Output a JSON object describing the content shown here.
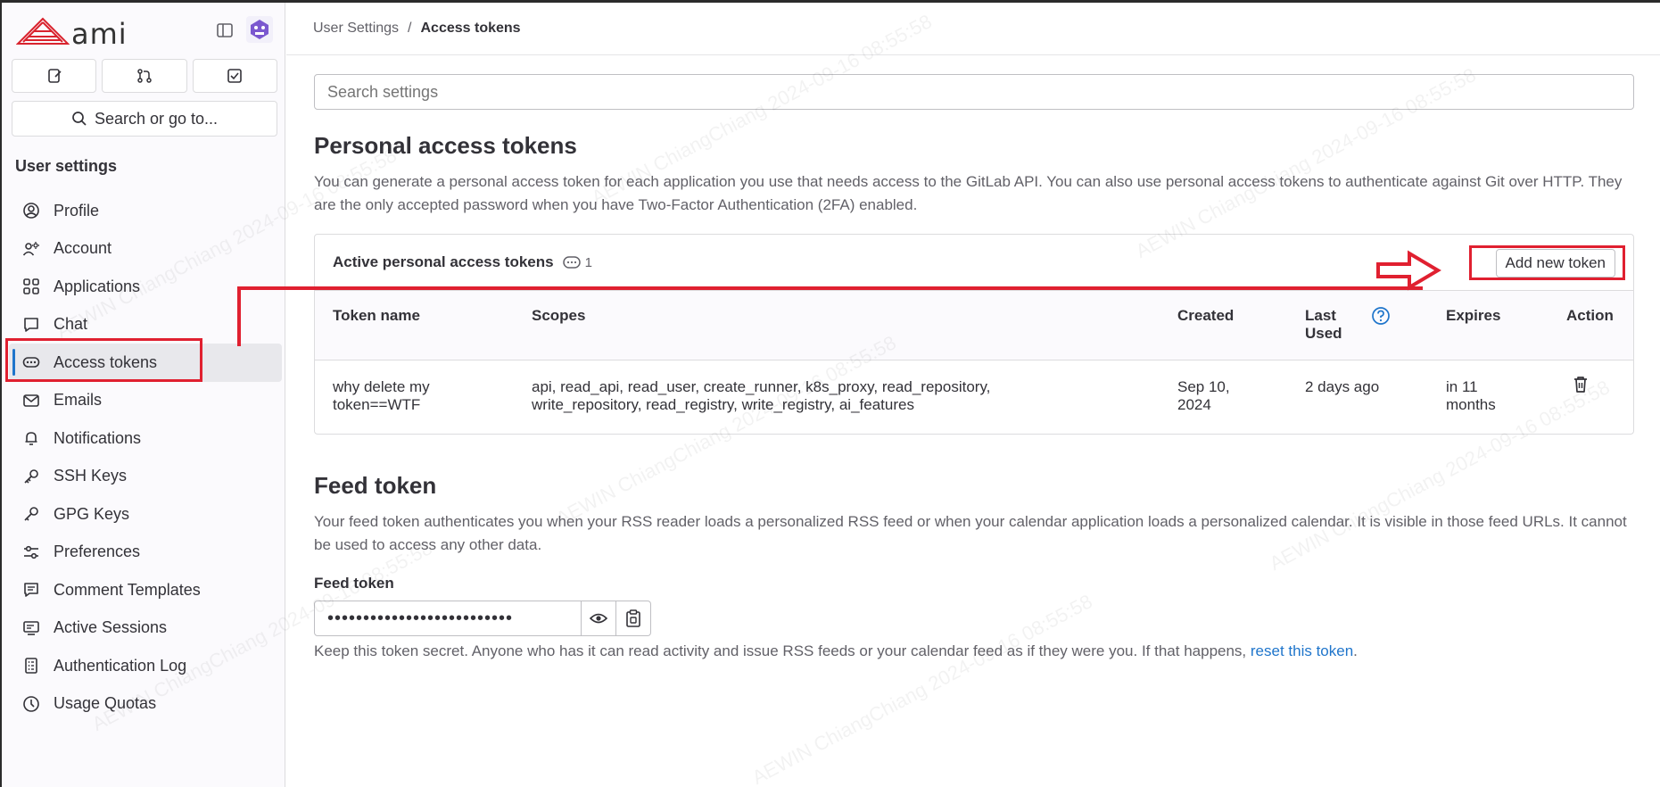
{
  "app": {
    "logo_text": "ami"
  },
  "sidebar": {
    "search_label": "Search or go to...",
    "section_title": "User settings",
    "items": [
      {
        "label": "Profile",
        "icon": "profile-icon"
      },
      {
        "label": "Account",
        "icon": "account-icon"
      },
      {
        "label": "Applications",
        "icon": "applications-icon"
      },
      {
        "label": "Chat",
        "icon": "chat-icon"
      },
      {
        "label": "Access tokens",
        "icon": "access-tokens-icon",
        "active": true
      },
      {
        "label": "Emails",
        "icon": "email-icon"
      },
      {
        "label": "Notifications",
        "icon": "bell-icon"
      },
      {
        "label": "SSH Keys",
        "icon": "key-icon"
      },
      {
        "label": "GPG Keys",
        "icon": "key-icon"
      },
      {
        "label": "Preferences",
        "icon": "preferences-icon"
      },
      {
        "label": "Comment Templates",
        "icon": "comment-icon"
      },
      {
        "label": "Active Sessions",
        "icon": "monitor-icon"
      },
      {
        "label": "Authentication Log",
        "icon": "log-icon"
      },
      {
        "label": "Usage Quotas",
        "icon": "quota-icon"
      }
    ]
  },
  "breadcrumb": {
    "parent": "User Settings",
    "separator": "/",
    "current": "Access tokens"
  },
  "search": {
    "placeholder": "Search settings"
  },
  "pat": {
    "title": "Personal access tokens",
    "description": "You can generate a personal access token for each application you use that needs access to the GitLab API. You can also use personal access tokens to authenticate against Git over HTTP. They are the only accepted password when you have Two-Factor Authentication (2FA) enabled.",
    "card_title": "Active personal access tokens",
    "count": "1",
    "add_button": "Add new token",
    "columns": {
      "name": "Token name",
      "scopes": "Scopes",
      "created": "Created",
      "last_used_1": "Last",
      "last_used_2": "Used",
      "expires": "Expires",
      "action": "Action"
    },
    "rows": [
      {
        "name_1": "why delete my",
        "name_2": "token==WTF",
        "scopes_1": "api, read_api, read_user, create_runner, k8s_proxy, read_repository,",
        "scopes_2": "write_repository, read_registry, write_registry, ai_features",
        "created_1": "Sep 10,",
        "created_2": "2024",
        "last_used": "2 days ago",
        "expires_1": "in 11",
        "expires_2": "months"
      }
    ]
  },
  "feed": {
    "title": "Feed token",
    "description": "Your feed token authenticates you when your RSS reader loads a personalized RSS feed or when your calendar application loads a personalized calendar. It is visible in those feed URLs. It cannot be used to access any other data.",
    "label": "Feed token",
    "masked_value": "••••••••••••••••••••••••••",
    "help_text": "Keep this token secret. Anyone who has it can read activity and issue RSS feeds or your calendar feed as if they were you. If that happens, ",
    "help_link": "reset this token",
    "help_end": "."
  },
  "watermark": "AEWIN ChiangChiang 2024-09-16 08:55:58",
  "colors": {
    "accent": "#1f75cb",
    "annotation": "#e02030",
    "logo_red": "#d9232e"
  }
}
